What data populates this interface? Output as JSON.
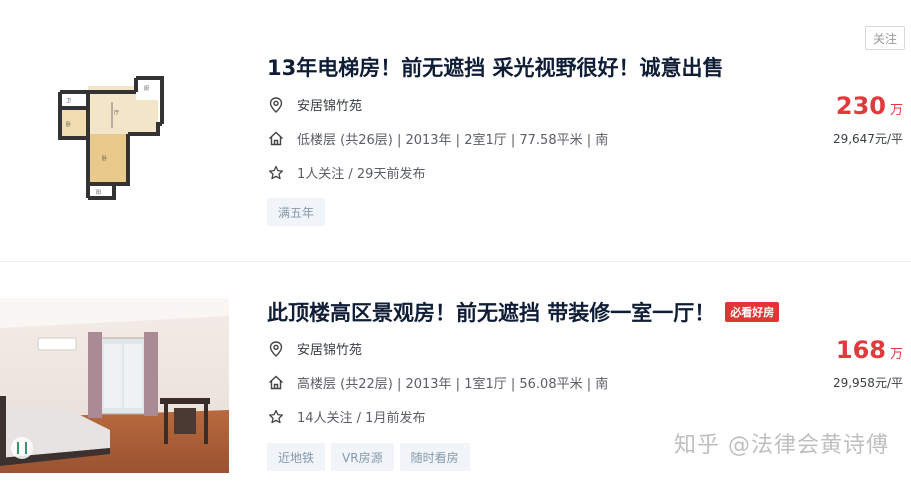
{
  "follow_button": "关注",
  "listings": [
    {
      "title": "13年电梯房！前无遮挡 采光视野很好！诚意出售",
      "community": "安居锦竹苑",
      "house_info": "低楼层 (共26层) | 2013年 | 2室1厅 | 77.58平米 | 南",
      "follow_info": "1人关注 / 29天前发布",
      "tags": [
        "满五年"
      ],
      "total_price": "230",
      "price_unit": "万",
      "unit_price": "29,647元/平"
    },
    {
      "title": "此顶楼高区景观房！前无遮挡 带装修一室一厅！",
      "badge": "必看好房",
      "community": "安居锦竹苑",
      "house_info": "高楼层 (共22层) | 2013年 | 1室1厅 | 56.08平米 | 南",
      "follow_info": "14人关注 / 1月前发布",
      "tags": [
        "近地铁",
        "VR房源",
        "随时看房"
      ],
      "total_price": "168",
      "price_unit": "万",
      "unit_price": "29,958元/平"
    }
  ],
  "watermark": "知乎 @法律会黄诗傅",
  "colors": {
    "price": "#e4393c",
    "title": "#101d37",
    "tag_bg": "#f1f4f8",
    "tag_text": "#849aae",
    "badge": "#e03636"
  },
  "icons": {
    "community": "location-pin-icon",
    "house": "house-icon",
    "follow": "star-icon"
  }
}
